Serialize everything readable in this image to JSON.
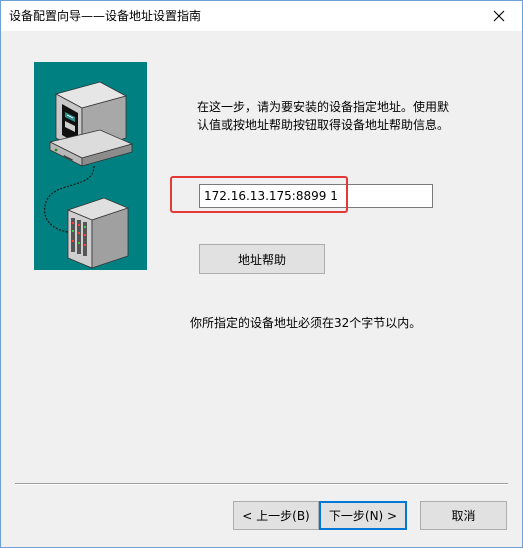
{
  "window": {
    "title": "设备配置向导——设备地址设置指南",
    "close_glyph": "✕"
  },
  "main": {
    "description_line1": "在这一步，请为要安装的设备指定地址。使用默",
    "description_line2": "认值或按地址帮助按钮取得设备地址帮助信息。",
    "address_value": "172.16.13.175:8899 1",
    "address_help_label": "地址帮助",
    "note": "你所指定的设备地址必须在32个字节以内。"
  },
  "footer": {
    "back_label": "< 上一步(B)",
    "next_label": "下一步(N) >",
    "cancel_label": "取消"
  },
  "colors": {
    "illustration_bg": "#008080",
    "highlight": "#e53935",
    "default_button_border": "#0078d7"
  },
  "icons": {
    "close": "close-icon",
    "computer": "computer-illustration",
    "device": "device-rack-illustration"
  }
}
